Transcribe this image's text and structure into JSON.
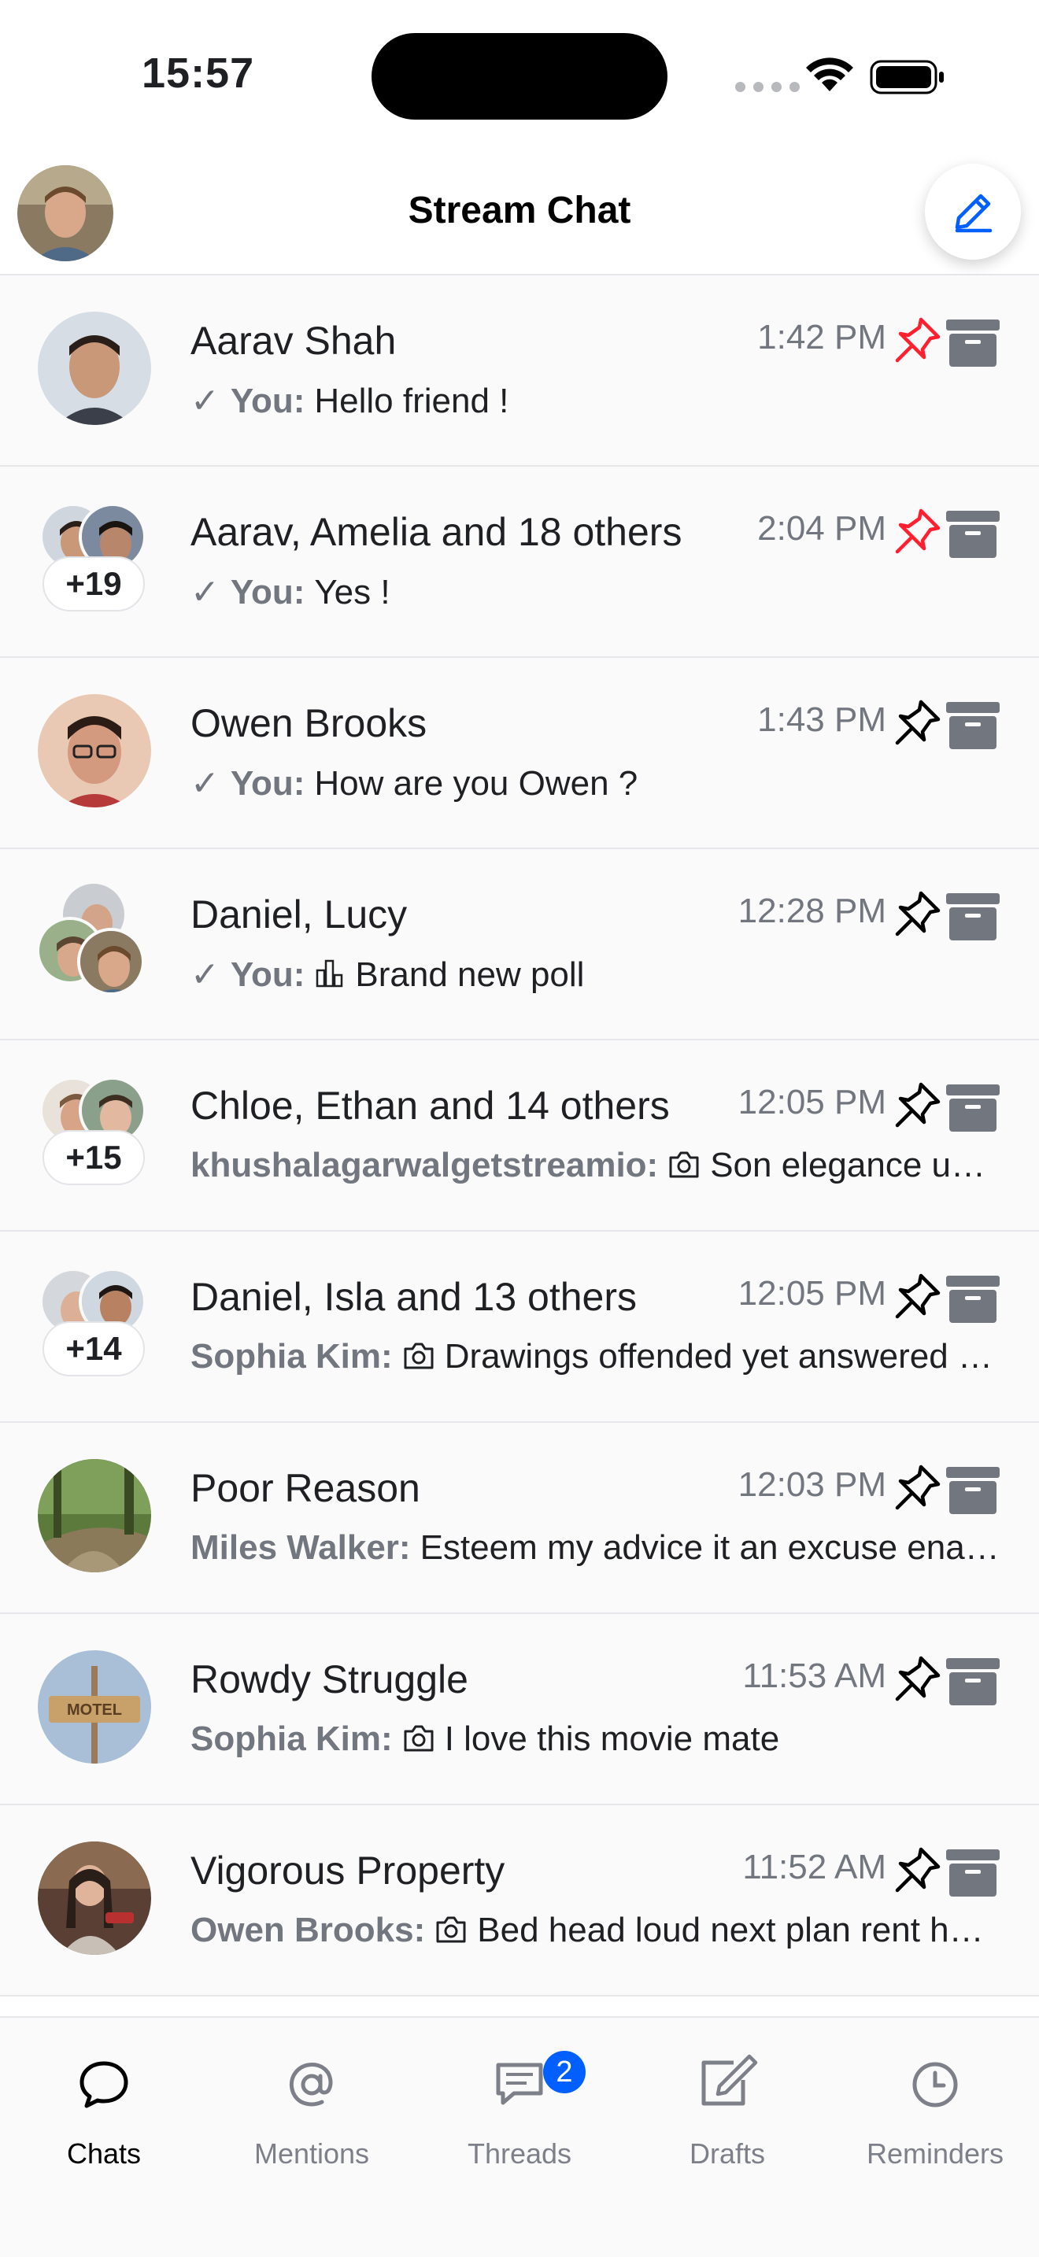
{
  "status_bar": {
    "time": "15:57"
  },
  "header": {
    "title": "Stream Chat",
    "compose_icon": "pencil-icon"
  },
  "chats": [
    {
      "name": "Aarav Shah",
      "time": "1:42 PM",
      "pinned": true,
      "sender": "You:",
      "read": true,
      "attachment": "",
      "message": "Hello friend !"
    },
    {
      "name": "Aarav, Amelia and 18 others",
      "time": "2:04 PM",
      "pinned": true,
      "sender": "You:",
      "read": true,
      "attachment": "",
      "message": "Yes !",
      "member_badge": "+19"
    },
    {
      "name": "Owen Brooks",
      "time": "1:43 PM",
      "pinned": false,
      "sender": "You:",
      "read": true,
      "attachment": "",
      "message": "How are you Owen ?"
    },
    {
      "name": "Daniel, Lucy",
      "time": "12:28 PM",
      "pinned": false,
      "sender": "You:",
      "read": true,
      "attachment": "poll-icon",
      "message": "Brand new poll"
    },
    {
      "name": "Chloe, Ethan and 14 others",
      "time": "12:05 PM",
      "pinned": false,
      "sender": "khushalagarwalgetstreamio:",
      "read": false,
      "attachment": "camera-icon",
      "message": "Son elegance use weddings separate. Ask too matter formed county wicket oppose talent.",
      "member_badge": "+15"
    },
    {
      "name": "Daniel, Isla and 13 others",
      "time": "12:05 PM",
      "pinned": false,
      "sender": "Sophia Kim:",
      "read": false,
      "attachment": "camera-icon",
      "message": "Drawings offended yet answered Jennings perceive laughing six did far.",
      "member_badge": "+14"
    },
    {
      "name": "Poor Reason",
      "time": "12:03 PM",
      "pinned": false,
      "sender": "Miles Walker:",
      "read": false,
      "attachment": "",
      "message": "Esteem my advice it an excuse enable. Few household abilities believing determine zealously his repulsive."
    },
    {
      "name": "Rowdy Struggle",
      "time": "11:53 AM",
      "pinned": false,
      "sender": "Sophia Kim:",
      "read": false,
      "attachment": "camera-icon",
      "message": "I love this movie mate"
    },
    {
      "name": "Vigorous Property",
      "time": "11:52 AM",
      "pinned": false,
      "sender": "Owen Brooks:",
      "read": false,
      "attachment": "camera-icon",
      "message": "Bed head loud next plan rent has sell."
    }
  ],
  "tabs": [
    {
      "label": "Chats",
      "icon": "chat-bubble-icon",
      "active": true
    },
    {
      "label": "Mentions",
      "icon": "at-sign-icon",
      "active": false
    },
    {
      "label": "Threads",
      "icon": "threads-icon",
      "active": false,
      "badge": "2"
    },
    {
      "label": "Drafts",
      "icon": "draft-edit-icon",
      "active": false
    },
    {
      "label": "Reminders",
      "icon": "clock-icon",
      "active": false
    }
  ],
  "colors": {
    "accent": "#005fff",
    "pinned": "#ff1f2e",
    "muted": "#72767e",
    "archive": "#72767e"
  }
}
